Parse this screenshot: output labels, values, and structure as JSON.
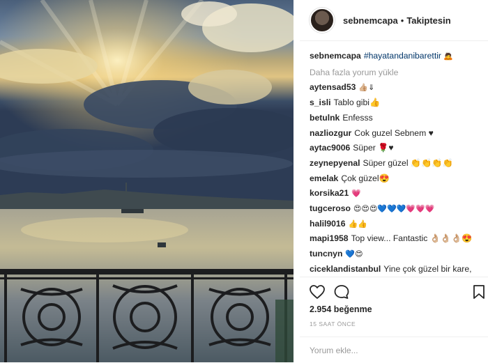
{
  "post": {
    "username": "sebnemcapa",
    "separator": "•",
    "follow_status": "Takiptesin",
    "caption_hashtag": "#hayatandanibarettir",
    "caption_emoji": "🙇",
    "load_more": "Daha fazla yorum yükle",
    "likes": "2.954 beğenme",
    "timestamp": "15 SAAT ÖNCE",
    "add_comment_placeholder": "Yorum ekle..."
  },
  "comments": [
    {
      "user": "aytensad53",
      "text": "👍🏼⇓"
    },
    {
      "user": "s_isli",
      "text": "Tablo gibi👍"
    },
    {
      "user": "betulnk",
      "text": "Enfesss"
    },
    {
      "user": "nazliozgur",
      "text": "Cok guzel Sebnem ♥"
    },
    {
      "user": "aytac9006",
      "text": "Süper 🌹♥"
    },
    {
      "user": "zeynepyenal",
      "text": "Süper güzel 👏👏👏👏"
    },
    {
      "user": "emelak",
      "text": "Çok güzel😍"
    },
    {
      "user": "korsika21",
      "text": "💗"
    },
    {
      "user": "tugceroso",
      "text": "😍😍😍💙💙💙💗💗💗"
    },
    {
      "user": "halil9016",
      "text": "👍👍"
    },
    {
      "user": "mapi1958",
      "text": "Top view... Fantastic 👌🏼👌🏼👌🏼😍"
    },
    {
      "user": "tuncnyn",
      "text": "💙😍"
    },
    {
      "user": "ciceklandistanbul",
      "text": "Yine çok güzel bir kare, ellerinize sağlık 👏👏👏"
    }
  ],
  "icons": {
    "like": "heart-icon",
    "comment": "speech-bubble-icon",
    "save": "bookmark-icon"
  }
}
